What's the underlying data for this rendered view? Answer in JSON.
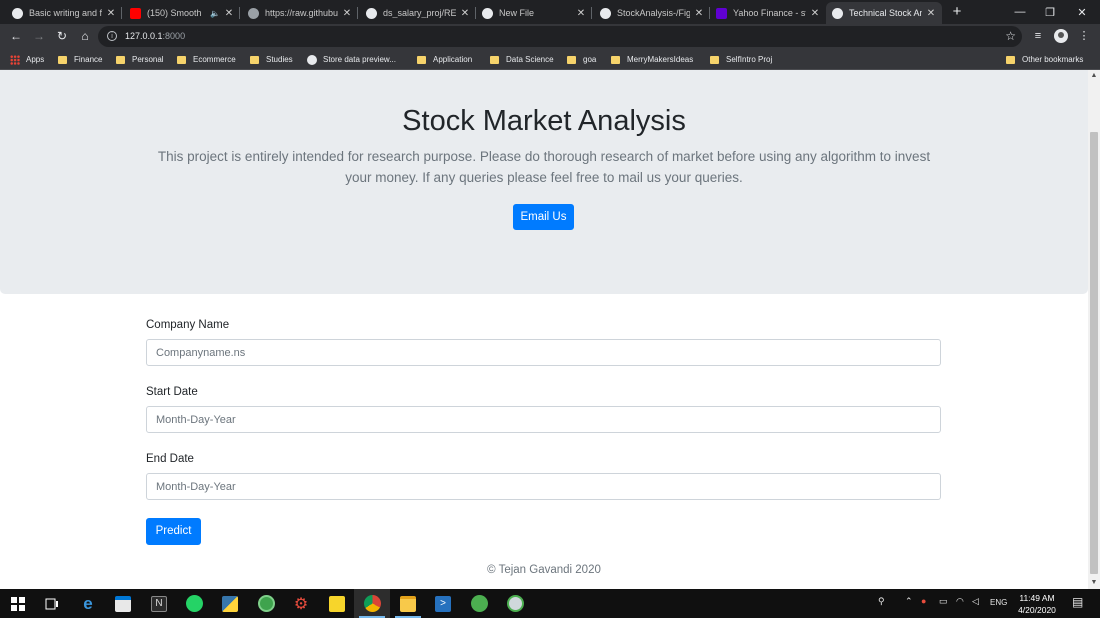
{
  "browser": {
    "tabs": [
      {
        "title": "Basic writing and fo",
        "icon": "github-icon",
        "favicon_color": "#e8eaed",
        "active": false
      },
      {
        "title": "(150) Smooth",
        "icon": "youtube-icon",
        "favicon_color": "#ff0000",
        "active": false,
        "audio": true
      },
      {
        "title": "https://raw.githubu",
        "icon": "globe-icon",
        "favicon_color": "#9aa0a6",
        "active": false
      },
      {
        "title": "ds_salary_proj/REA",
        "icon": "github-icon",
        "favicon_color": "#e8eaed",
        "active": false
      },
      {
        "title": "New File",
        "icon": "github-icon",
        "favicon_color": "#e8eaed",
        "active": false
      },
      {
        "title": "StockAnalysis-/Fig",
        "icon": "github-icon",
        "favicon_color": "#e8eaed",
        "active": false
      },
      {
        "title": "Yahoo Finance - st",
        "icon": "yahoo-icon",
        "favicon_color": "#6001d2",
        "active": false
      },
      {
        "title": "Technical Stock An",
        "icon": "globe-icon",
        "favicon_color": "#e8eaed",
        "active": true
      }
    ],
    "new_tab_label": "+",
    "url_host": "127.0.0.1",
    "url_rest": ":8000",
    "bookmarks": [
      {
        "label": "Apps",
        "kind": "apps"
      },
      {
        "label": "Finance",
        "kind": "folder"
      },
      {
        "label": "Personal",
        "kind": "folder"
      },
      {
        "label": "Ecommerce",
        "kind": "folder"
      },
      {
        "label": "Studies",
        "kind": "folder"
      },
      {
        "label": "Store data preview...",
        "kind": "site"
      },
      {
        "label": "Application",
        "kind": "folder"
      },
      {
        "label": "Data Science",
        "kind": "folder"
      },
      {
        "label": "goa",
        "kind": "folder"
      },
      {
        "label": "MerryMakersIdeas",
        "kind": "folder"
      },
      {
        "label": "SelfIntro Proj",
        "kind": "folder"
      }
    ],
    "other_bookmarks": "Other bookmarks"
  },
  "page": {
    "title": "Stock Market Analysis",
    "lead_line1": "This project is entirely intended for research purpose. Please do thorough research of market before using any algorithm to invest",
    "lead_line2": "your money. If any queries please feel free to mail us your queries.",
    "email_button": "Email Us",
    "form": {
      "company_label": "Company Name",
      "company_placeholder": "Companyname.ns",
      "start_label": "Start Date",
      "start_placeholder": "Month-Day-Year",
      "end_label": "End Date",
      "end_placeholder": "Month-Day-Year",
      "predict_button": "Predict"
    },
    "footer": "© Tejan Gavandi 2020",
    "accent_color": "#007bff"
  },
  "taskbar": {
    "language": "ENG",
    "time": "11:49 AM",
    "date": "4/20/2020",
    "apps": [
      "start-icon",
      "task-view-icon",
      "edge-icon",
      "store-icon",
      "notion-icon",
      "whatsapp-icon",
      "python-icon",
      "globe-app-icon",
      "settings-icon",
      "sticky-notes-icon",
      "chrome-icon",
      "file-explorer-icon",
      "powershell-icon",
      "green-app-icon",
      "browser-app-icon"
    ]
  }
}
